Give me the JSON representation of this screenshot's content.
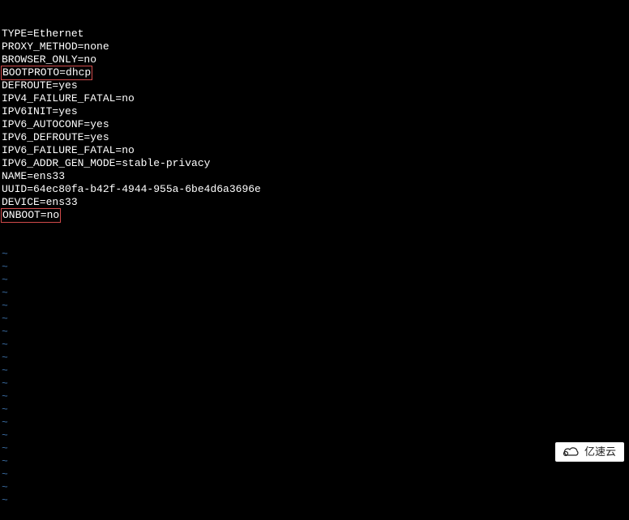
{
  "config": {
    "lines": [
      {
        "text": "TYPE=Ethernet",
        "highlight": false
      },
      {
        "text": "PROXY_METHOD=none",
        "highlight": false
      },
      {
        "text": "BROWSER_ONLY=no",
        "highlight": false
      },
      {
        "text": "BOOTPROTO=dhcp",
        "highlight": true
      },
      {
        "text": "DEFROUTE=yes",
        "highlight": false
      },
      {
        "text": "IPV4_FAILURE_FATAL=no",
        "highlight": false
      },
      {
        "text": "IPV6INIT=yes",
        "highlight": false
      },
      {
        "text": "IPV6_AUTOCONF=yes",
        "highlight": false
      },
      {
        "text": "IPV6_DEFROUTE=yes",
        "highlight": false
      },
      {
        "text": "IPV6_FAILURE_FATAL=no",
        "highlight": false
      },
      {
        "text": "IPV6_ADDR_GEN_MODE=stable-privacy",
        "highlight": false
      },
      {
        "text": "NAME=ens33",
        "highlight": false
      },
      {
        "text": "UUID=64ec80fa-b42f-4944-955a-6be4d6a3696e",
        "highlight": false
      },
      {
        "text": "DEVICE=ens33",
        "highlight": false
      },
      {
        "text": "ONBOOT=no",
        "highlight": true
      }
    ]
  },
  "editor": {
    "tilde": "~",
    "tilde_count": 20
  },
  "watermark": {
    "label": "亿速云"
  },
  "colors": {
    "bg": "#000000",
    "fg": "#ffffff",
    "tilde": "#3b6ea5",
    "highlight_border": "#d14b4b"
  }
}
